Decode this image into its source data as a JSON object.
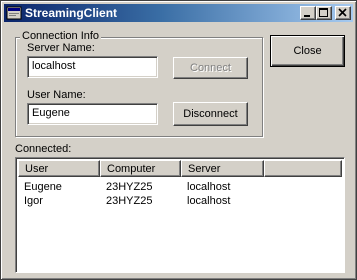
{
  "window": {
    "title": "StreamingClient"
  },
  "connection": {
    "group_label": "Connection Info",
    "server_label": "Server Name:",
    "server_value": "localhost",
    "user_label": "User Name:",
    "user_value": "Eugene",
    "connect_label": "Connect",
    "disconnect_label": "Disconnect"
  },
  "close_label": "Close",
  "connected": {
    "label": "Connected:",
    "columns": [
      "User",
      "Computer",
      "Server"
    ],
    "rows": [
      [
        "Eugene",
        "23HYZ25",
        "localhost"
      ],
      [
        "Igor",
        "23HYZ25",
        "localhost"
      ]
    ]
  }
}
